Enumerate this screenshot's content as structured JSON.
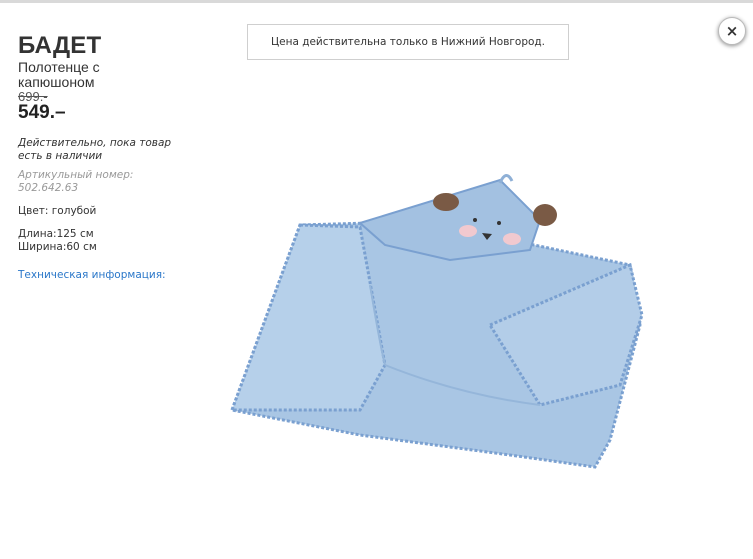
{
  "product": {
    "name": "БАДЕТ",
    "description": "Полотенце с капюшоном",
    "old_price": "699.-",
    "price": "549.–",
    "availability": "Действительно, пока товар есть в наличии",
    "article": "Артикульный номер: 502.642.63",
    "color": "Цвет: голубой",
    "length": "Длина:125 см",
    "width": "Ширина:60 см",
    "tech_info_link": "Техническая информация:"
  },
  "notice": {
    "text": "Цена действительна только в Нижний Новгород."
  },
  "close_button": {
    "icon": "close-icon",
    "glyph": "×"
  },
  "colors": {
    "link": "#2a77c9",
    "towel": "#a9c6e4",
    "towel_trim": "#7aa0d0"
  }
}
